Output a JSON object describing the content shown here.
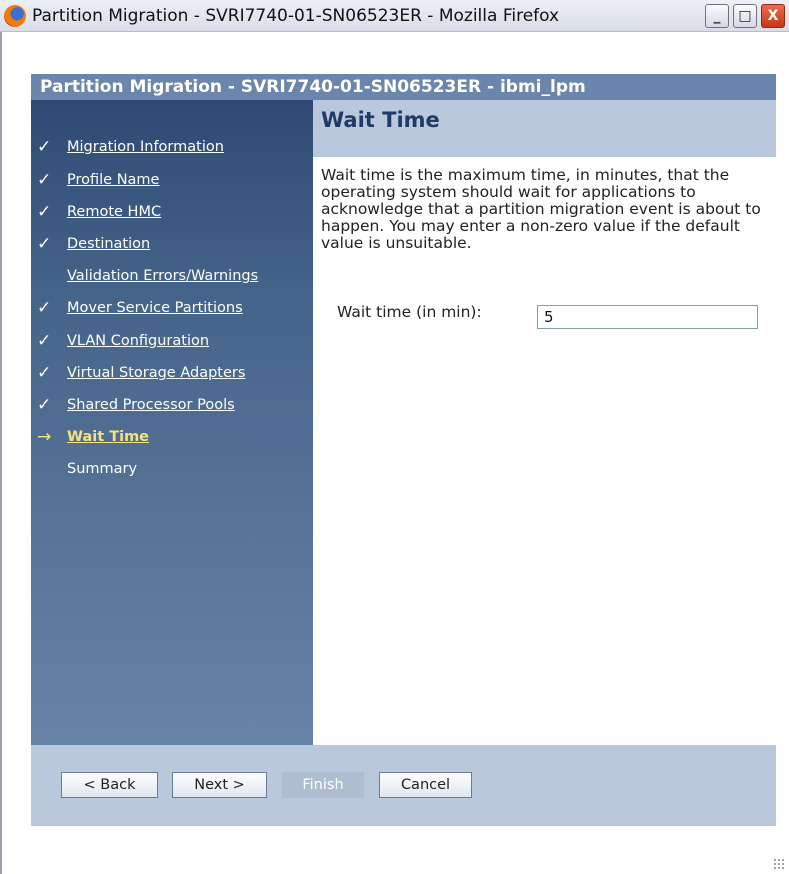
{
  "window": {
    "title": "Partition Migration - SVRI7740-01-SN06523ER - Mozilla Firefox",
    "minimize_glyph": "_",
    "maximize_glyph": "□",
    "close_glyph": "X"
  },
  "panel": {
    "header": "Partition Migration - SVRI7740-01-SN06523ER - ibmi_lpm"
  },
  "nav": {
    "items": [
      {
        "label": "Migration Information",
        "mark": "✓"
      },
      {
        "label": "Profile Name",
        "mark": "✓"
      },
      {
        "label": "Remote HMC",
        "mark": "✓"
      },
      {
        "label": "Destination",
        "mark": "✓"
      },
      {
        "label": "Validation Errors/Warnings",
        "mark": ""
      },
      {
        "label": "Mover Service Partitions",
        "mark": "✓"
      },
      {
        "label": "VLAN Configuration",
        "mark": "✓"
      },
      {
        "label": "Virtual Storage Adapters",
        "mark": "✓"
      },
      {
        "label": "Shared Processor Pools",
        "mark": "✓"
      },
      {
        "label": "Wait Time",
        "mark": "→"
      },
      {
        "label": "Summary",
        "mark": ""
      }
    ]
  },
  "content": {
    "title": "Wait Time",
    "description": "Wait time is the maximum time, in minutes, that the operating system should wait for applications to acknowledge that a partition migration event is about to happen. You may enter a non-zero value if the default value is unsuitable.",
    "field_label": "Wait time (in min):",
    "field_value": "5"
  },
  "footer": {
    "back": "< Back",
    "next": "Next >",
    "finish": "Finish",
    "cancel": "Cancel"
  }
}
